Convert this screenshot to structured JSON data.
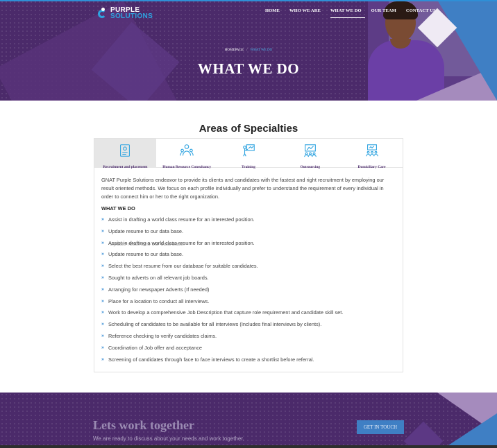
{
  "colors": {
    "brand_purple": "#4b2a6a",
    "accent_blue": "#2ea3e0",
    "button_blue": "#3f7fc4",
    "bullet_blue": "#3b8fd6"
  },
  "header": {
    "logo": {
      "line1": "PURPLE",
      "line2": "SOLUTIONS",
      "icon": "purple-solutions-logo-icon"
    },
    "nav": [
      {
        "label": "HOME"
      },
      {
        "label": "WHO WE ARE"
      },
      {
        "label": "WHAT WE DO",
        "active": true
      },
      {
        "label": "OUR TEAM"
      },
      {
        "label": "CONTACT US"
      }
    ],
    "breadcrumb": {
      "home": "HOMEPAGE",
      "separator": "/",
      "current": "WHAT WE DO"
    },
    "title": "WHAT WE DO"
  },
  "main": {
    "section_title": "Areas of Specialties",
    "tabs": [
      {
        "label": "Recruitment and placement",
        "icon": "resume-icon",
        "active": true
      },
      {
        "label": "Human Resource Consultancy",
        "icon": "team-icon"
      },
      {
        "label": "Training",
        "icon": "presentation-icon"
      },
      {
        "label": "Outsourcing",
        "icon": "meeting-icon"
      },
      {
        "label": "Domiciliary Care",
        "icon": "group-care-icon"
      }
    ],
    "intro": "GNAT Purple Solutions endeavor to provide its clients and candidates with the fastest and right recruitment by employing our result oriented methods. We focus on each profile individually and prefer to understand the requirement of every individual in order to connect him or her to the right organization.",
    "subhead": "WHAT WE DO",
    "items": [
      "Assist in drafting a world class resume for an interested position.",
      "Update resume to our data base.",
      "Assist in drafting a world class resume for an interested position.",
      "Update resume to our data base.",
      "Select the best resume from our database for suitable candidates.",
      "Sought to adverts on all relevant job boards.",
      "Arranging for newspaper Adverts (If needed)",
      "Place for a location to conduct all interviews.",
      "Work to develop a comprehensive Job Description that capture role requirement and candidate skill set.",
      "Scheduling of candidates to be available for all interviews (Includes final interviews by clients).",
      "Reference checking to verify candidates claims.",
      "Coordination of Job offer and acceptance",
      "Screening of candidates through face to face interviews to create a shortlist before referral."
    ],
    "overlap_text": "Update resume to our data base."
  },
  "cta": {
    "title": "Lets work together",
    "subtitle": "We are ready to discuss about your needs and work together.",
    "button": "GET IN TOUCH"
  }
}
